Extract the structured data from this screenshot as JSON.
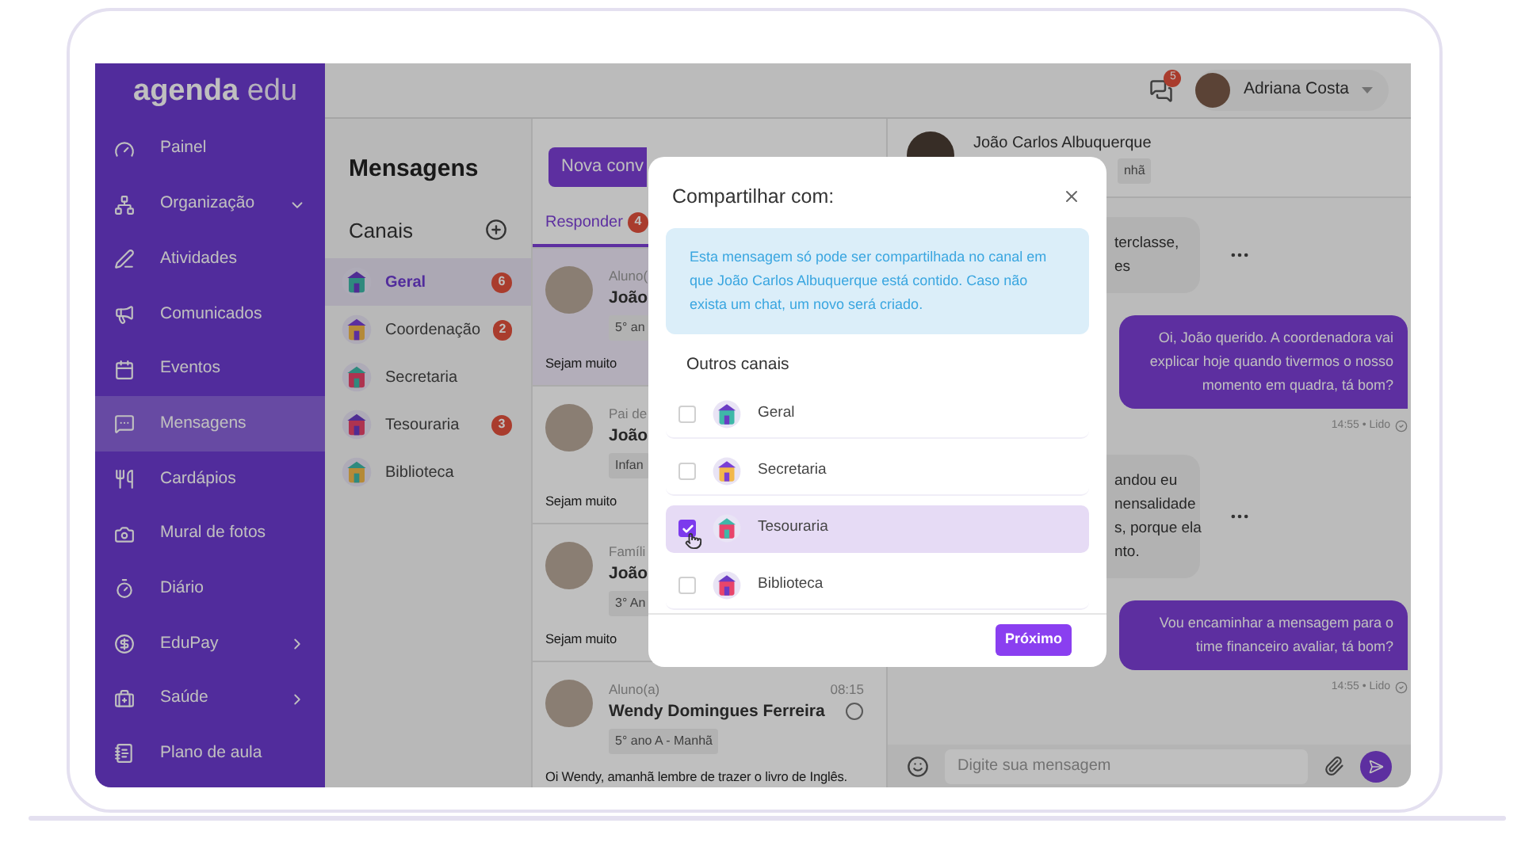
{
  "logo": {
    "primary": "agenda",
    "secondary": "edu"
  },
  "sidebar": {
    "items": [
      {
        "label": "Painel",
        "selected": false,
        "kind": "link"
      },
      {
        "label": "Organização",
        "selected": false,
        "kind": "dropdown"
      },
      {
        "label": "Atividades",
        "selected": false,
        "kind": "link"
      },
      {
        "label": "Comunicados",
        "selected": false,
        "kind": "link"
      },
      {
        "label": "Eventos",
        "selected": false,
        "kind": "link"
      },
      {
        "label": "Mensagens",
        "selected": true,
        "kind": "link"
      },
      {
        "label": "Cardápios",
        "selected": false,
        "kind": "link"
      },
      {
        "label": "Mural de fotos",
        "selected": false,
        "kind": "link"
      },
      {
        "label": "Diário",
        "selected": false,
        "kind": "link"
      },
      {
        "label": "EduPay",
        "selected": false,
        "kind": "flyout"
      },
      {
        "label": "Saúde",
        "selected": false,
        "kind": "flyout"
      },
      {
        "label": "Plano de aula",
        "selected": false,
        "kind": "link"
      }
    ]
  },
  "topbar": {
    "notification_count": "5",
    "user_name": "Adriana Costa"
  },
  "channels_panel": {
    "title": "Mensagens",
    "section": "Canais",
    "channels": [
      {
        "name": "Geral",
        "badge": "6",
        "selected": true
      },
      {
        "name": "Coordenação",
        "badge": "2",
        "selected": false
      },
      {
        "name": "Secretaria",
        "selected": false
      },
      {
        "name": "Tesouraria",
        "badge": "3",
        "selected": false
      },
      {
        "name": "Biblioteca",
        "selected": false
      }
    ]
  },
  "conversations": {
    "new_button": "Nova conv",
    "tabs": [
      {
        "label": "Responder",
        "badge": "4",
        "selected": true
      }
    ],
    "items": [
      {
        "role": "Aluno(",
        "name": "João",
        "chip": "5° an",
        "preview": "Sejam muito",
        "selected": true
      },
      {
        "role": "Pai de",
        "name": "João",
        "chip": "Infan",
        "preview": "Sejam muito",
        "selected": false
      },
      {
        "role": "Famíli",
        "name": "João",
        "chip": "3° An",
        "preview": "Sejam muito",
        "selected": false
      },
      {
        "role": "Aluno(a)",
        "time": "08:15",
        "name": "Wendy Domingues Ferreira",
        "chip": "5° ano A - Manhã",
        "preview": "Oi Wendy, amanhã lembre de trazer o livro de Inglês.",
        "selected": false
      }
    ]
  },
  "chat": {
    "contact_name": "João Carlos Albuquerque",
    "contact_chip": "nhã",
    "messages": [
      {
        "kind": "received",
        "lines": [
          "terclasse,",
          "es"
        ]
      },
      {
        "kind": "sent",
        "text": "Oi, João querido. A coordenadora vai explicar hoje quando tivermos o nosso momento em quadra, tá bom?",
        "meta": "14:55 • Lido"
      },
      {
        "kind": "received",
        "lines": [
          "andou eu",
          "nensalidade",
          "s, porque ela",
          "nto."
        ]
      },
      {
        "kind": "sent",
        "text": "Vou encaminhar a mensagem para o time financeiro avaliar, tá bom?",
        "meta": "14:55 • Lido"
      }
    ],
    "composer_placeholder": "Digite sua mensagem"
  },
  "modal": {
    "title": "Compartilhar com:",
    "notice": "Esta mensagem só pode ser compartilhada no canal em que João Carlos Albuquerque está contido. Caso não exista um chat, um novo será criado.",
    "section": "Outros canais",
    "options": [
      {
        "name": "Geral",
        "checked": false
      },
      {
        "name": "Secretaria",
        "checked": false
      },
      {
        "name": "Tesouraria",
        "checked": true
      },
      {
        "name": "Biblioteca",
        "checked": false
      }
    ],
    "next_button": "Próximo"
  }
}
